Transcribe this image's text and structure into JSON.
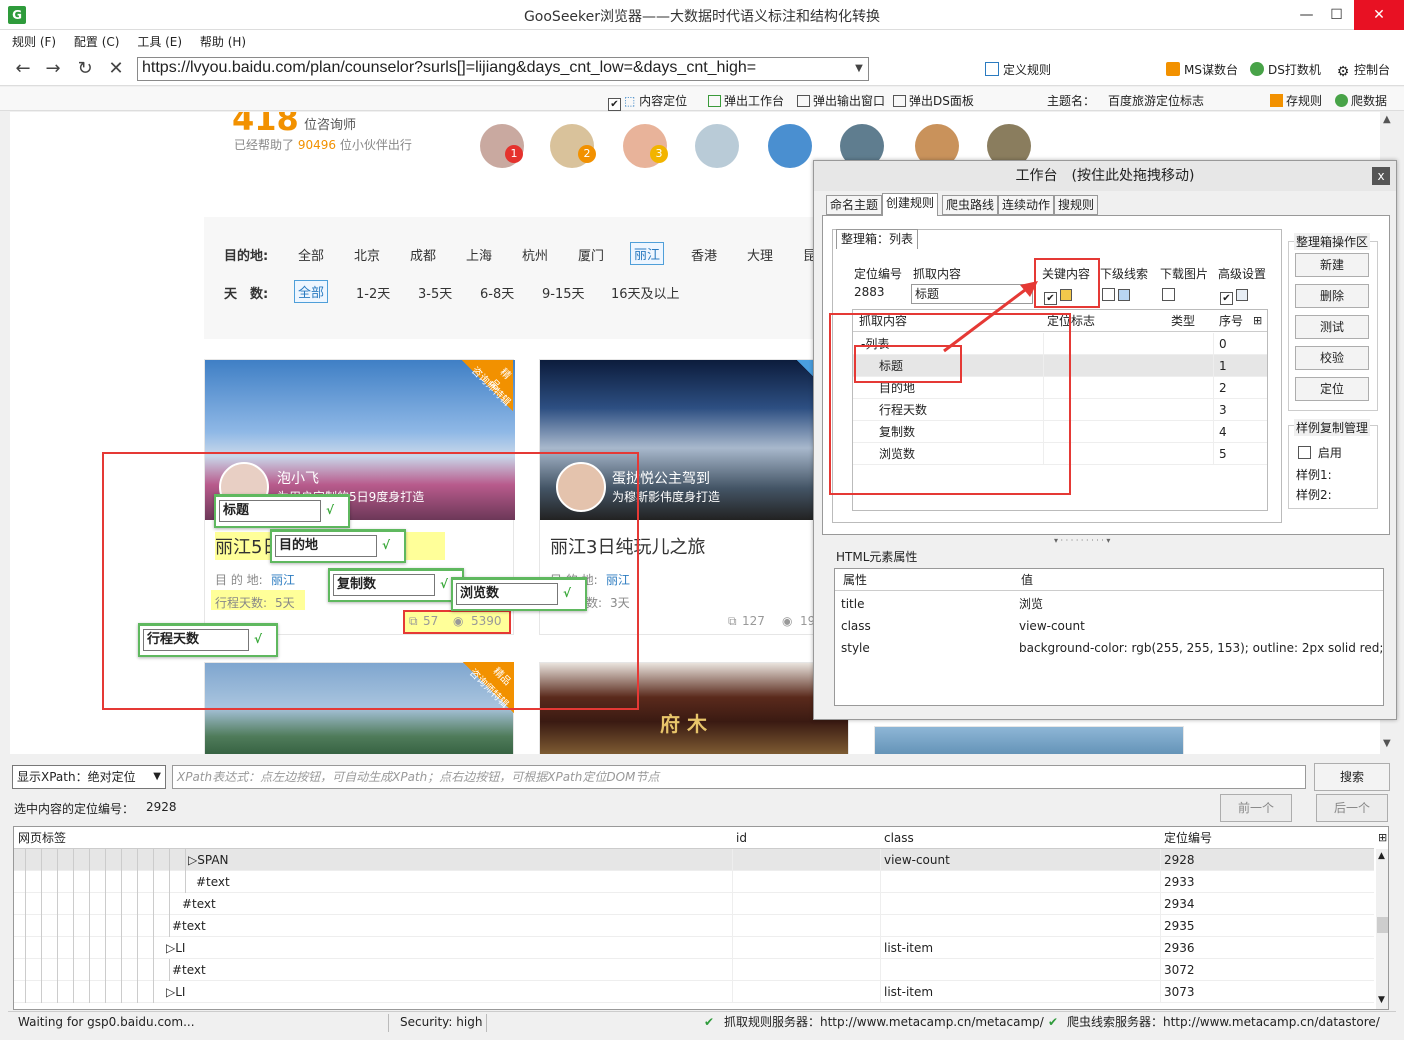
{
  "window": {
    "title": "GooSeeker浏览器——大数据时代语义标注和结构化转换",
    "app_icon": "G"
  },
  "menu": [
    "规则 (F)",
    "配置 (C)",
    "工具 (E)",
    "帮助 (H)"
  ],
  "address": {
    "url": "https://lvyou.baidu.com/plan/counselor?surls[]=lijiang&days_cnt_low=&days_cnt_high=",
    "define_rule": "定义规则",
    "ms_console": "MS谋数台",
    "ds_crawler": "DS打数机",
    "control_panel": "控制台"
  },
  "toolbar2": {
    "content_locate": "内容定位",
    "popup_workbench": "弹出工作台",
    "popup_output": "弹出输出窗口",
    "popup_ds": "弹出DS面板",
    "theme_label": "主题名：",
    "theme_name": "百度旅游定位标志",
    "save_rule": "存规则",
    "crawl_data": "爬数据"
  },
  "page": {
    "counselor_count": "418",
    "counselor_unit": "位咨询师",
    "helped_prefix": "已经帮助了",
    "helped_count": "90496",
    "helped_suffix": "位小伙伴出行",
    "badges": [
      "1",
      "2",
      "3"
    ],
    "filter": {
      "dest_label": "目的地:",
      "destinations": [
        "全部",
        "北京",
        "成都",
        "上海",
        "杭州",
        "厦门",
        "丽江",
        "香港",
        "大理",
        "昆"
      ],
      "selected_dest": "丽江",
      "days_label": "天　数:",
      "days": [
        "全部",
        "1-2天",
        "3-5天",
        "6-8天",
        "9-15天",
        "16天及以上"
      ],
      "selected_days": "全部"
    },
    "corner_tag": "咨询师特辑",
    "corner_tag2": "精品",
    "card1": {
      "author": "泡小飞",
      "subtitle": "为用户定制的5日9度身打造",
      "title": "丽江5日",
      "dest_label": "目 的 地:",
      "dest": "丽江",
      "days_label": "行程天数:",
      "days": "5天",
      "copies": "57",
      "views": "5390"
    },
    "card2": {
      "author": "蛋挞悦公主驾到",
      "subtitle": "为穆斯影伟度身打造",
      "title": "丽江3日纯玩儿之旅",
      "dest_label": "目 的 地:",
      "dest": "丽江",
      "days_label": "行程天数:",
      "days": "3天",
      "copies": "127",
      "views": "19"
    },
    "sign_text": "府 木"
  },
  "popups": {
    "title": "标题",
    "dest": "目的地",
    "copies": "复制数",
    "views": "浏览数",
    "days": "行程天数",
    "ok": "√"
  },
  "workbench": {
    "header": "工作台　(按住此处拖拽移动)",
    "close": "x",
    "tabs": [
      "命名主题",
      "创建规则",
      "爬虫路线",
      "连续动作",
      "搜规则"
    ],
    "active_tab": "创建规则",
    "box_tab": "整理箱：列表",
    "loc_no_label": "定位编号",
    "loc_no": "2883",
    "capture_label": "抓取内容",
    "capture_value": "标题",
    "key_content": "关键内容",
    "sub_clue": "下级线索",
    "download_img": "下载图片",
    "advanced": "高级设置",
    "grid_headers": [
      "抓取内容",
      "定位标志",
      "类型",
      "序号"
    ],
    "grid_rows": [
      {
        "name": "-列表",
        "seq": "0"
      },
      {
        "name": "标题",
        "seq": "1"
      },
      {
        "name": "目的地",
        "seq": "2"
      },
      {
        "name": "行程天数",
        "seq": "3"
      },
      {
        "name": "复制数",
        "seq": "4"
      },
      {
        "name": "浏览数",
        "seq": "5"
      }
    ],
    "ops_title": "整理箱操作区",
    "ops": [
      "新建",
      "删除",
      "测试",
      "校验",
      "定位"
    ],
    "sample_title": "样例复制管理",
    "enable": "启用",
    "sample1": "样例1:",
    "sample2": "样例2:",
    "html_attr_title": "HTML元素属性",
    "attr_headers": [
      "属性",
      "值"
    ],
    "attrs": [
      {
        "k": "title",
        "v": "浏览"
      },
      {
        "k": "class",
        "v": "view-count"
      },
      {
        "k": "style",
        "v": "background-color: rgb(255, 255, 153); outline: 2px solid red;"
      }
    ]
  },
  "bottom": {
    "xpath_mode": "显示XPath：绝对定位",
    "xpath_placeholder": "XPath表达式：点左边按钮，可自动生成XPath；点右边按钮，可根据XPath定位DOM节点",
    "search": "搜索",
    "selected_label": "选中内容的定位编号：",
    "selected_no": "2928",
    "prev": "前一个",
    "next": "后一个",
    "tree_headers": [
      "网页标签",
      "id",
      "class",
      "定位编号"
    ],
    "tree_rows": [
      {
        "tag": "▷SPAN",
        "id": "",
        "cls": "view-count",
        "no": "2928"
      },
      {
        "tag": "#text",
        "id": "",
        "cls": "",
        "no": "2933"
      },
      {
        "tag": "#text",
        "id": "",
        "cls": "",
        "no": "2934"
      },
      {
        "tag": "#text",
        "id": "",
        "cls": "",
        "no": "2935"
      },
      {
        "tag": "▷LI",
        "id": "",
        "cls": "list-item",
        "no": "2936"
      },
      {
        "tag": "#text",
        "id": "",
        "cls": "",
        "no": "3072"
      },
      {
        "tag": "▷LI",
        "id": "",
        "cls": "list-item",
        "no": "3073"
      }
    ]
  },
  "status": {
    "waiting": "Waiting for gsp0.baidu.com...",
    "security": "Security: high",
    "rule_server": "抓取规则服务器：http://www.metacamp.cn/metacamp/",
    "clue_server": "爬虫线索服务器：http://www.metacamp.cn/datastore/"
  }
}
